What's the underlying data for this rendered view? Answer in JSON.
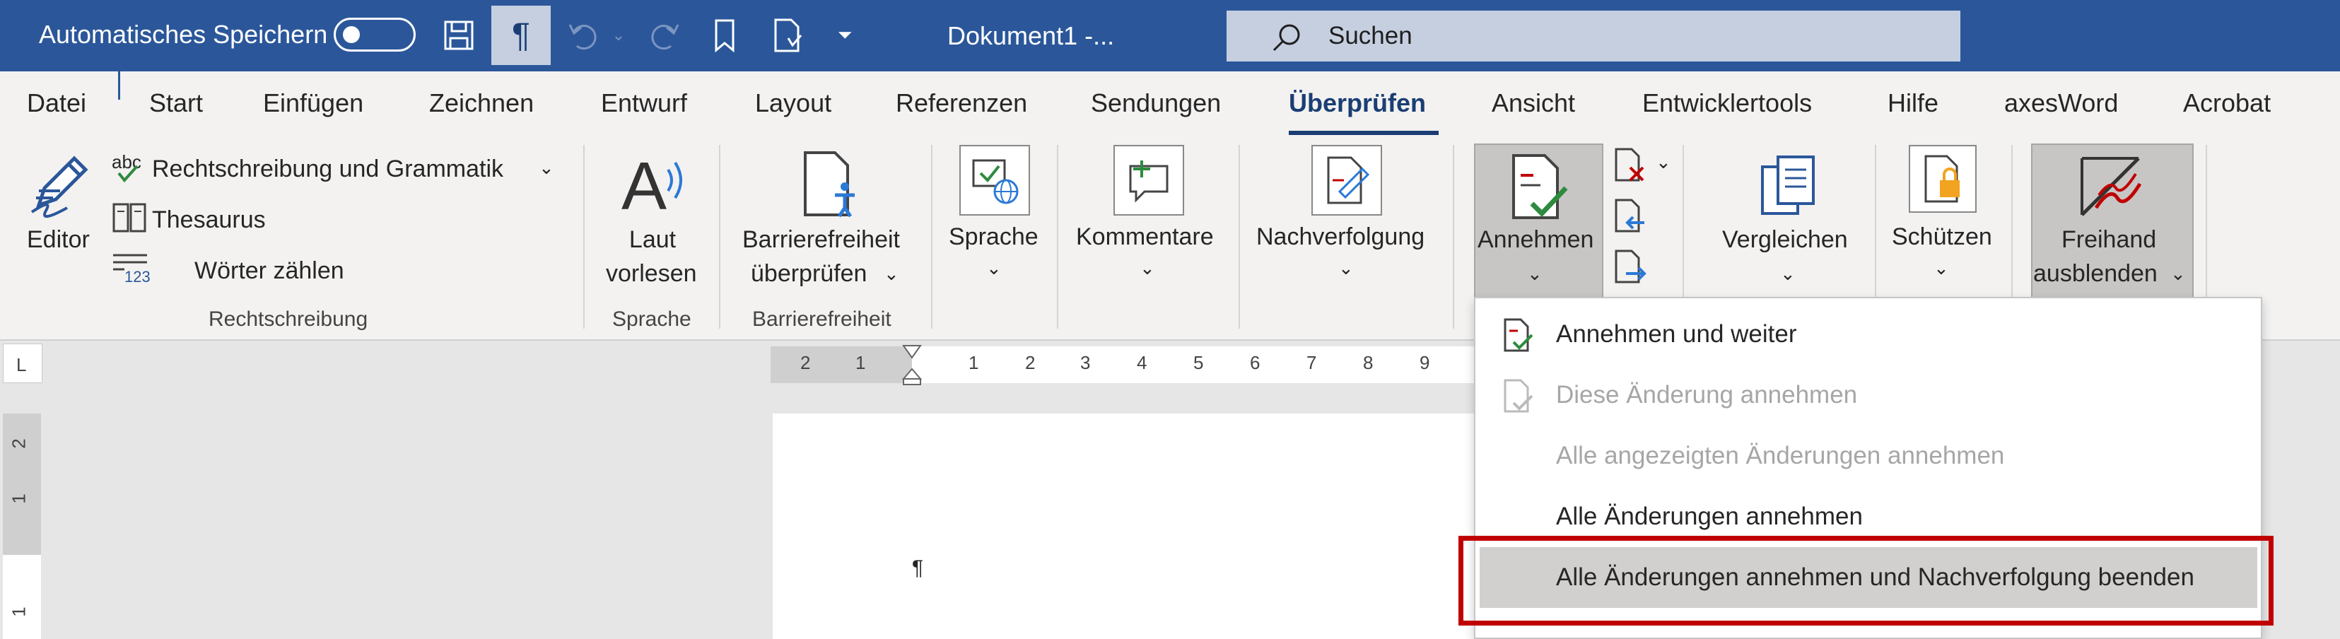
{
  "titlebar": {
    "autosave_label": "Automatisches Speichern",
    "document_title": "Dokument1  -...",
    "search_placeholder": "Suchen"
  },
  "tabs": [
    {
      "label": "Datei"
    },
    {
      "label": "Start"
    },
    {
      "label": "Einfügen"
    },
    {
      "label": "Zeichnen"
    },
    {
      "label": "Entwurf"
    },
    {
      "label": "Layout"
    },
    {
      "label": "Referenzen"
    },
    {
      "label": "Sendungen"
    },
    {
      "label": "Überprüfen",
      "active": true
    },
    {
      "label": "Ansicht"
    },
    {
      "label": "Entwicklertools"
    },
    {
      "label": "Hilfe"
    },
    {
      "label": "axesWord"
    },
    {
      "label": "Acrobat"
    }
  ],
  "ribbon": {
    "editor": "Editor",
    "spelling": "Rechtschreibung und Grammatik",
    "thesaurus": "Thesaurus",
    "word_count": "Wörter zählen",
    "group_rechtschreibung": "Rechtschreibung",
    "read_aloud_1": "Laut",
    "read_aloud_2": "vorlesen",
    "group_sprache": "Sprache",
    "access_1": "Barrierefreiheit",
    "access_2": "überprüfen",
    "group_barriere": "Barrierefreiheit",
    "language": "Sprache",
    "comments": "Kommentare",
    "tracking": "Nachverfolgung",
    "accept": "Annehmen",
    "compare": "Vergleichen",
    "protect": "Schützen",
    "ink_1": "Freihand",
    "ink_2": "ausblenden",
    "abc_label": "abc"
  },
  "ruler": {
    "h_marks": [
      "2",
      "1",
      "1",
      "2",
      "3",
      "4",
      "5",
      "6",
      "7",
      "8",
      "9"
    ],
    "v_marks": [
      "2",
      "1",
      "1"
    ]
  },
  "document": {
    "pilcrow": "¶"
  },
  "accept_menu": {
    "items": [
      {
        "label": "Annehmen und weiter",
        "disabled": false
      },
      {
        "label": "Diese Änderung annehmen",
        "disabled": true
      },
      {
        "label": "Alle angezeigten Änderungen annehmen",
        "disabled": true
      },
      {
        "label": "Alle Änderungen annehmen",
        "disabled": false
      },
      {
        "label": "Alle Änderungen annehmen und Nachverfolgung beenden",
        "disabled": false,
        "hovered": true
      }
    ]
  },
  "colors": {
    "titlebar": "#2b579a",
    "ribbon": "#f3f2f1",
    "highlight": "#c00000",
    "check_green": "#2e8b3e"
  }
}
